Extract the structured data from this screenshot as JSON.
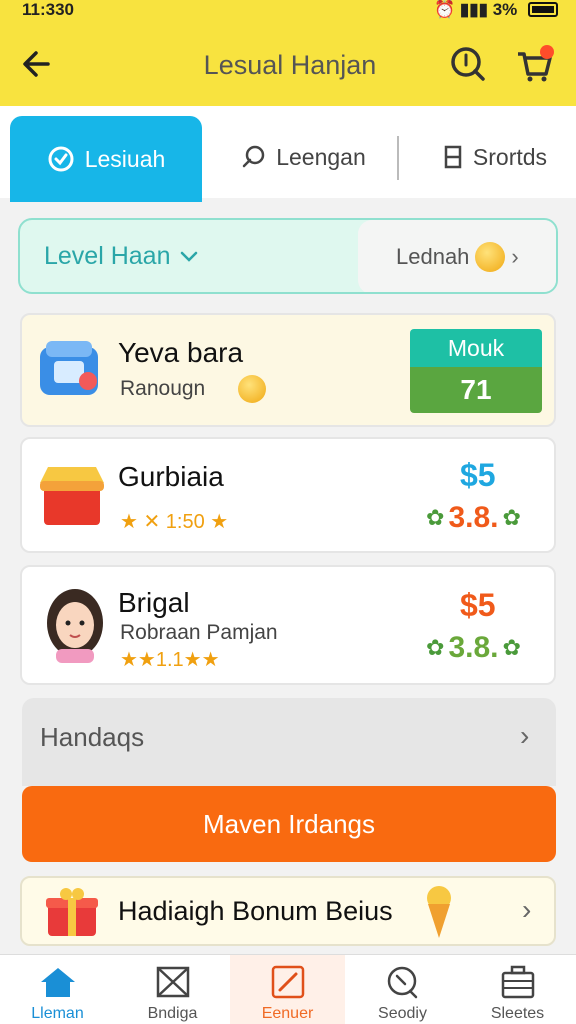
{
  "status_bar": {
    "time": "11:330",
    "battery": "3%"
  },
  "header": {
    "title": "Lesual Hanjan"
  },
  "tabs": [
    {
      "label": "Lesiuah"
    },
    {
      "label": "Leengan"
    },
    {
      "label": "Srortds"
    }
  ],
  "level": {
    "label": "Level Haan",
    "right_label": "Lednah"
  },
  "items": [
    {
      "name": "Yeva bara",
      "sub": "Ranougn",
      "badge_top": "Mouk",
      "badge_bottom": "71"
    },
    {
      "name": "Gurbiaia",
      "stars_text": "★ ✕ 1:50 ★",
      "price": "$5",
      "sub_price": "3.8."
    },
    {
      "name": "Brigal",
      "sub": "Robraan Pamjan",
      "stars_text": "★★1.1★★",
      "price": "$5",
      "sub_price": "3.8."
    }
  ],
  "section": {
    "label": "Handaqs"
  },
  "cta": {
    "label": "Maven Irdangs"
  },
  "bonus": {
    "label": "Hadiaigh Bonum Beius"
  },
  "nav": [
    {
      "label": "Lleman"
    },
    {
      "label": "Bndiga"
    },
    {
      "label": "Eenuer"
    },
    {
      "label": "Seodiy"
    },
    {
      "label": "Sleetes"
    }
  ],
  "colors": {
    "header_bg": "#f8e33f",
    "tab_active": "#17b6e8",
    "cta": "#f96a10",
    "price_blue": "#1fa7e0",
    "price_orange": "#f05a1a"
  }
}
